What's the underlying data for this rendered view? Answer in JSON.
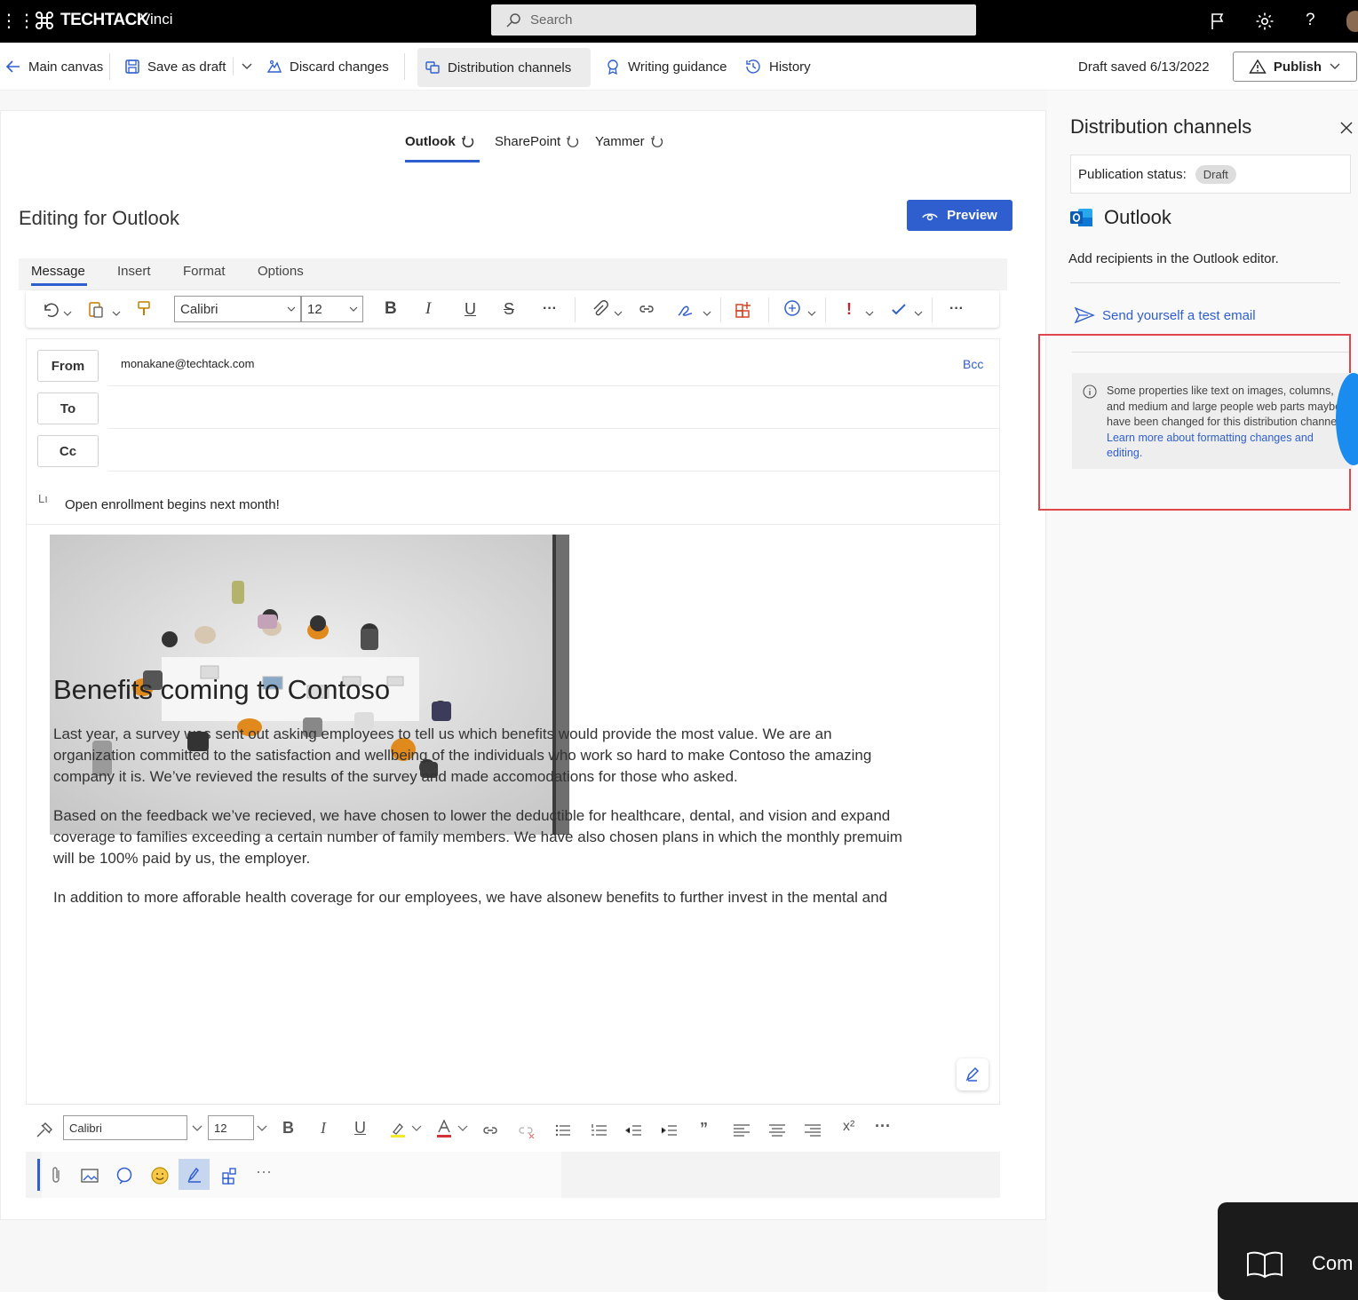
{
  "topbar": {
    "brand": "TECHTACK",
    "site_name": "Vinci",
    "search_placeholder": "Search"
  },
  "commandbar": {
    "main_canvas": "Main canvas",
    "save_as_draft": "Save as draft",
    "discard_changes": "Discard changes",
    "distribution_channels": "Distribution channels",
    "writing_guidance": "Writing guidance",
    "history": "History",
    "draft_status": "Draft saved 6/13/2022",
    "publish": "Publish"
  },
  "channel_tabs": [
    {
      "label": "Outlook",
      "active": true
    },
    {
      "label": "SharePoint",
      "active": false
    },
    {
      "label": "Yammer",
      "active": false
    }
  ],
  "editor": {
    "heading": "Editing for Outlook",
    "preview": "Preview",
    "ribbon_tabs": [
      "Message",
      "Insert",
      "Format",
      "Options"
    ],
    "font_name": "Calibri",
    "font_size": "12"
  },
  "email": {
    "from_label": "From",
    "to_label": "To",
    "cc_label": "Cc",
    "from_value": "monakane@techtack.com",
    "bcc": "Bcc",
    "subject_prefix": "Lı",
    "subject": "Open enrollment begins next month!",
    "title": "Benefits coming to Contoso",
    "paragraphs": [
      "Last year, a survey was sent out asking employees to tell us which benefits would provide the most value. We are an organization committed to the satisfaction and wellbeing of the individuals who work so hard to make Contoso the amazing company it is. We’ve revieved the results of the survey and made accomodations for those who asked.",
      "Based on the feedback we’ve recieved, we have chosen to lower the deductible for healthcare, dental, and vision and expand coverage to families exceeding a certain number of family members. We have also chosen plans in which the monthly premuim will be 100% paid by us, the employer.",
      "In addition to more afforable health coverage for our employees, we have alsonew benefits to further invest in the mental and"
    ]
  },
  "bottom_toolbar": {
    "font_name": "Calibri",
    "font_size": "12"
  },
  "panel": {
    "title": "Distribution channels",
    "publication_status_label": "Publication status:",
    "publication_status": "Draft",
    "channel": "Outlook",
    "recipients_text": "Add recipients in the Outlook editor.",
    "test_email": "Send yourself a test email",
    "info_text": "Some properties like text on images, columns, and medium and large people web parts maybe have been changed for this distribution channel.",
    "info_link": "Learn more about formatting changes and editing.",
    "float_label": "Com"
  },
  "colors": {
    "accent": "#2f5fcf",
    "highlight_box": "#e0474c",
    "topbar": "#000000"
  }
}
